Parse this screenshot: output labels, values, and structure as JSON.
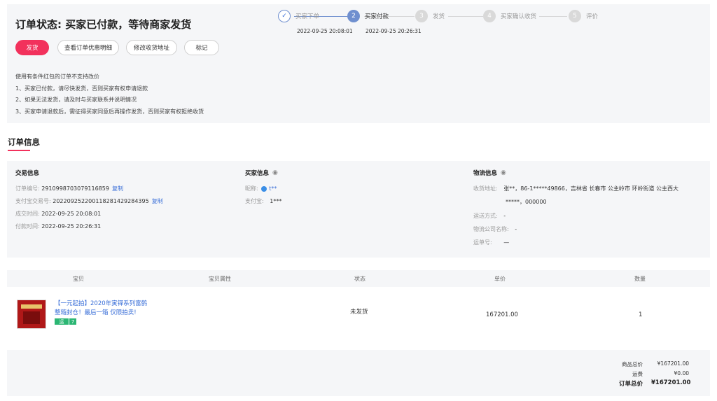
{
  "status": {
    "title": "订单状态: 买家已付款，等待商家发货",
    "buttons": [
      "发货",
      "查看订单优惠明细",
      "修改收货地址",
      "标记"
    ],
    "notes": [
      "使用有条件红包的订单不支持改价",
      "1、买家已付款，请尽快发货，否则买家有权申请退款",
      "2、如果无法发货，请及时与买家联系并说明情况",
      "3、买家申请退款后，需征得买家同意后再操作发货，否则买家有权拒绝收货"
    ]
  },
  "steps": [
    {
      "num": "✓",
      "label": "买家下单",
      "time": "2022-09-25 20:08:01"
    },
    {
      "num": "2",
      "label": "买家付款",
      "time": "2022-09-25 20:26:31"
    },
    {
      "num": "3",
      "label": "发货",
      "time": ""
    },
    {
      "num": "4",
      "label": "买家确认收货",
      "time": ""
    },
    {
      "num": "5",
      "label": "评价",
      "time": ""
    }
  ],
  "order_info": {
    "heading": "订单信息",
    "trade": {
      "title": "交易信息",
      "order_no_label": "订单编号: ",
      "order_no": "2910998703079116859",
      "copy1": "复制",
      "alipay_no_label": "支付宝交易号: ",
      "alipay_no": "2022092522001182814292843​95",
      "copy2": "复制",
      "created_label": "成交时间: ",
      "created": "2022-09-25 20:08:01",
      "paid_label": "付款时间: ",
      "paid": "2022-09-25 20:26:31"
    },
    "buyer": {
      "title": "买家信息",
      "nick_label": "昵称:",
      "nick": "t**",
      "alipay_label": "支付宝:",
      "alipay": "1***"
    },
    "logistics": {
      "title": "物流信息",
      "address_label": "收货地址:",
      "address_line1": "张**，86-1*****49866，吉林省 长春市 公主岭市 环岭街道 公主西大",
      "address_line2": "*****，000000",
      "ship_method_label": "运送方式:",
      "ship_method": "-",
      "company_label": "物流公司名称:",
      "company": "-",
      "tracking_label": "运单号:",
      "tracking": "—"
    }
  },
  "table": {
    "headers": [
      "宝贝",
      "宝贝属性",
      "状态",
      "单价",
      "数量"
    ],
    "product": {
      "title_line1": "【一元起拍】2020年寅铎系列富鹤",
      "title_line2": "整箱封仓！最后一箱 仅限拍卖!",
      "tag1": "运",
      "tag2": "7",
      "status": "未发货",
      "price": "167201.00",
      "qty": "1"
    }
  },
  "summary": {
    "goods_label": "商品总价",
    "goods": "¥167201.00",
    "shipping_label": "运费",
    "shipping": "¥0.00",
    "total_label": "订单总价",
    "total": "¥167201.00"
  },
  "colors": {
    "accent": "#f2315c",
    "step_active": "#6f8fcf",
    "link": "#3a6fd8",
    "panel": "#f5f6f8"
  }
}
